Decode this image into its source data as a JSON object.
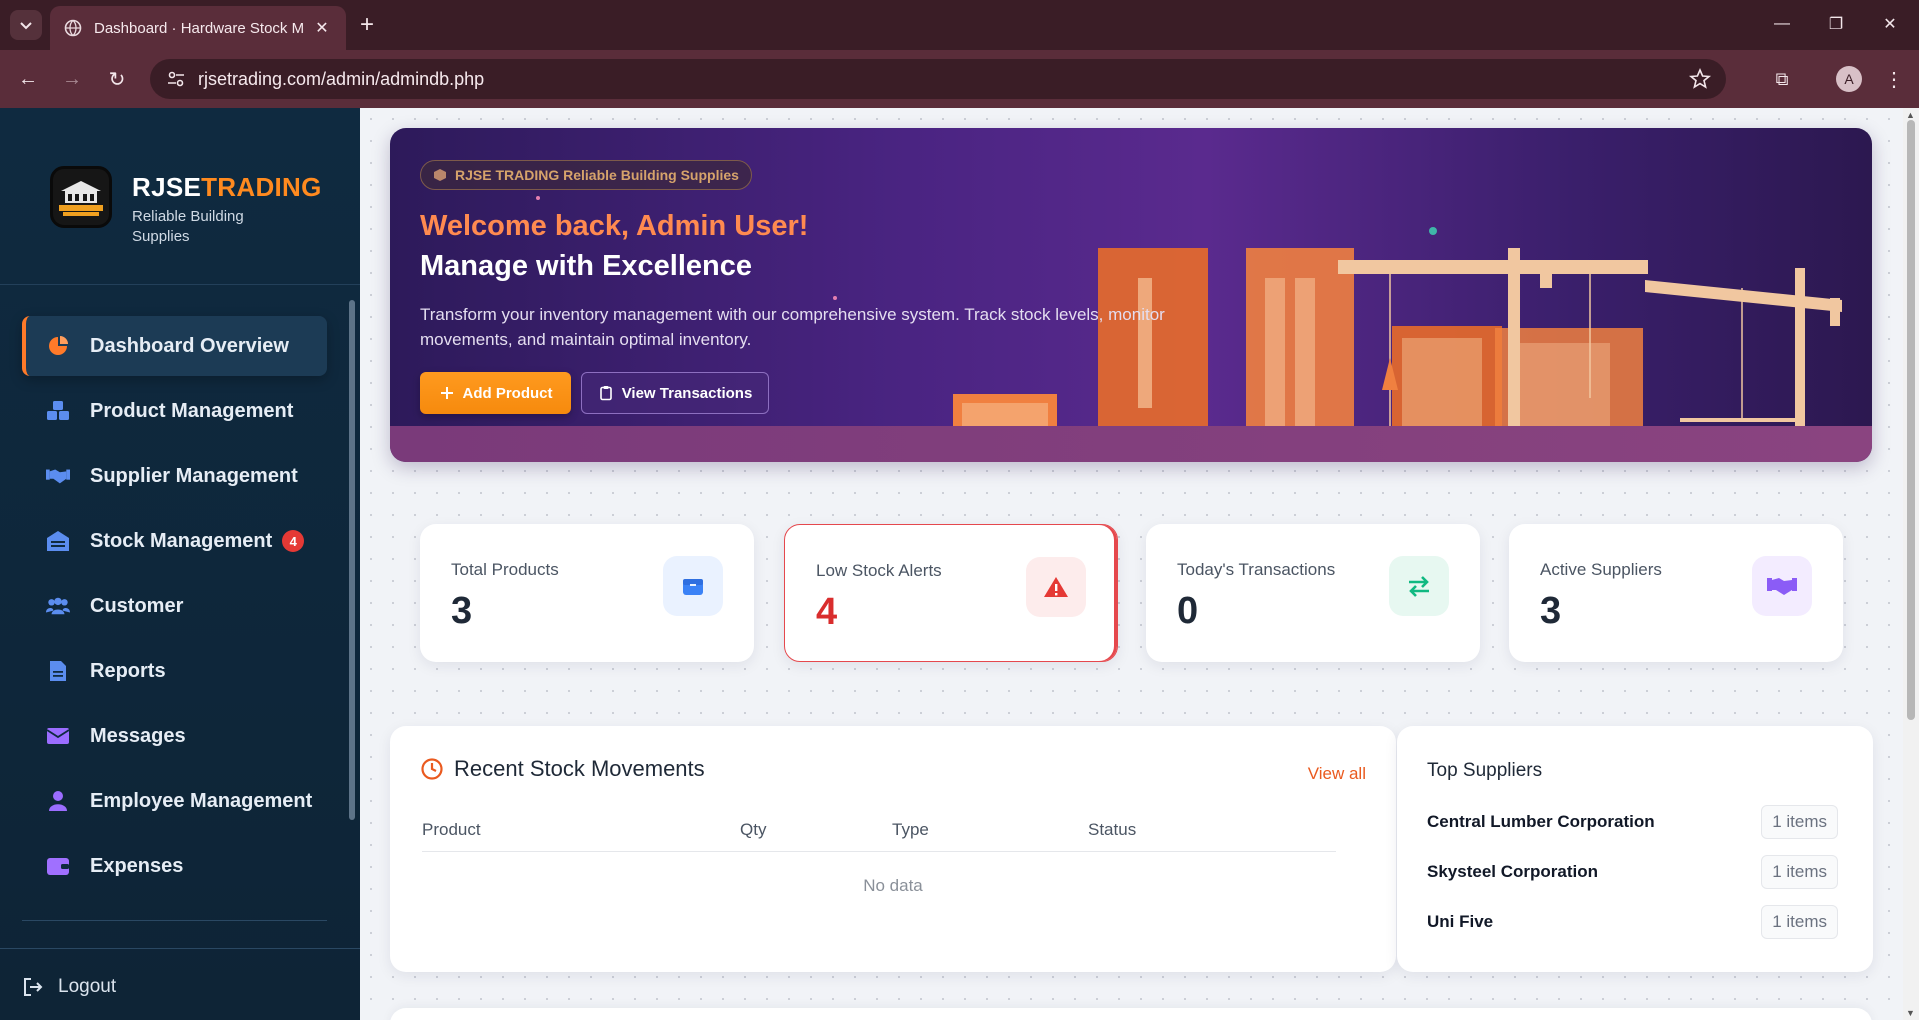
{
  "browser": {
    "tab_title": "Dashboard · Hardware Stock M",
    "url": "rjsetrading.com/admin/admindb.php",
    "profile_initial": "A"
  },
  "sidebar": {
    "brand_white": "RJSE",
    "brand_orange": "TRADING",
    "brand_sub": "Reliable Building Supplies",
    "logo_text": "RJSE TRADING",
    "items": [
      {
        "label": "Dashboard Overview",
        "icon": "pie-chart-icon",
        "active": true
      },
      {
        "label": "Product Management",
        "icon": "boxes-icon"
      },
      {
        "label": "Supplier Management",
        "icon": "handshake-icon"
      },
      {
        "label": "Stock Management",
        "icon": "warehouse-icon",
        "badge": "4"
      },
      {
        "label": "Customer",
        "icon": "users-icon"
      },
      {
        "label": "Reports",
        "icon": "file-icon"
      },
      {
        "label": "Messages",
        "icon": "envelope-icon"
      },
      {
        "label": "Employee Management",
        "icon": "user-icon"
      },
      {
        "label": "Expenses",
        "icon": "wallet-icon"
      }
    ],
    "logout_label": "Logout"
  },
  "hero": {
    "pill": "RJSE TRADING Reliable Building Supplies",
    "welcome": "Welcome back, Admin User!",
    "title": "Manage with Excellence",
    "description": "Transform your inventory management with our comprehensive system. Track stock levels, monitor movements, and maintain optimal inventory.",
    "add_button": "Add Product",
    "view_button": "View Transactions"
  },
  "stats": [
    {
      "label": "Total Products",
      "value": "3",
      "icon": "box-icon",
      "color": "#3b82f6"
    },
    {
      "label": "Low Stock Alerts",
      "value": "4",
      "icon": "warning-icon",
      "color": "#e53935"
    },
    {
      "label": "Today's Transactions",
      "value": "0",
      "icon": "exchange-icon",
      "color": "#10b981"
    },
    {
      "label": "Active Suppliers",
      "value": "3",
      "icon": "handshake-icon",
      "color": "#8b5cf6"
    }
  ],
  "recent": {
    "title": "Recent Stock Movements",
    "view_all": "View all",
    "columns": [
      "Product",
      "Qty",
      "Type",
      "Status"
    ],
    "empty": "No data"
  },
  "suppliers": {
    "title": "Top Suppliers",
    "rows": [
      {
        "name": "Central Lumber Corporation",
        "count": "1 items"
      },
      {
        "name": "Skysteel Corporation",
        "count": "1 items"
      },
      {
        "name": "Uni Five",
        "count": "1 items"
      }
    ]
  }
}
